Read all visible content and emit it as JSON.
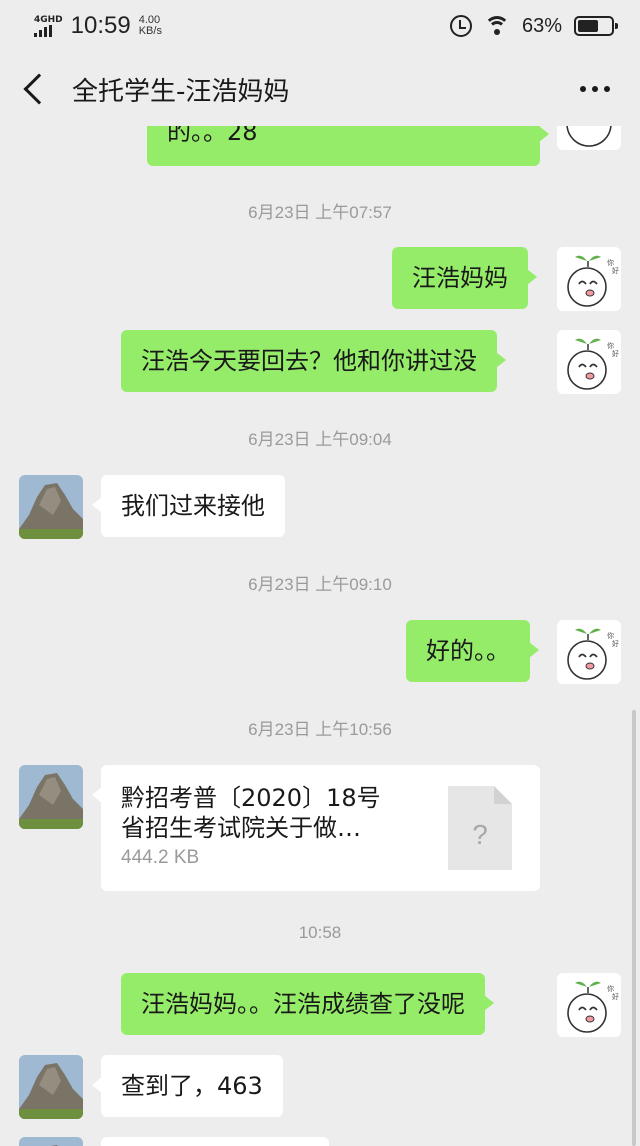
{
  "status_bar": {
    "network": "4GHD",
    "time": "10:59",
    "speed_value": "4.00",
    "speed_unit": "KB/s",
    "battery": "63%",
    "battery_level": 0.63
  },
  "header": {
    "title": "全托学生-汪浩妈妈"
  },
  "messages": {
    "m0": "的。。28",
    "t1": "6月23日 上午07:57",
    "m1": "汪浩妈妈",
    "m2": "汪浩今天要回去？他和你讲过没",
    "t2": "6月23日 上午09:04",
    "m3": "我们过来接他",
    "t3": "6月23日 上午09:10",
    "m4": "好的。。",
    "t4": "6月23日 上午10:56",
    "file": {
      "name_line1": "黔招考普〔2020〕18号",
      "name_line2": "省招生考试院关于做…",
      "size": "444.2 KB",
      "icon_glyph": "?"
    },
    "t5": "10:58",
    "m5": "汪浩妈妈。。汪浩成绩查了没呢",
    "m6": "查到了，463"
  },
  "colors": {
    "background": "#ededed",
    "outgoing_bubble": "#95ec69",
    "incoming_bubble": "#ffffff",
    "timestamp": "#9a9a9a"
  }
}
